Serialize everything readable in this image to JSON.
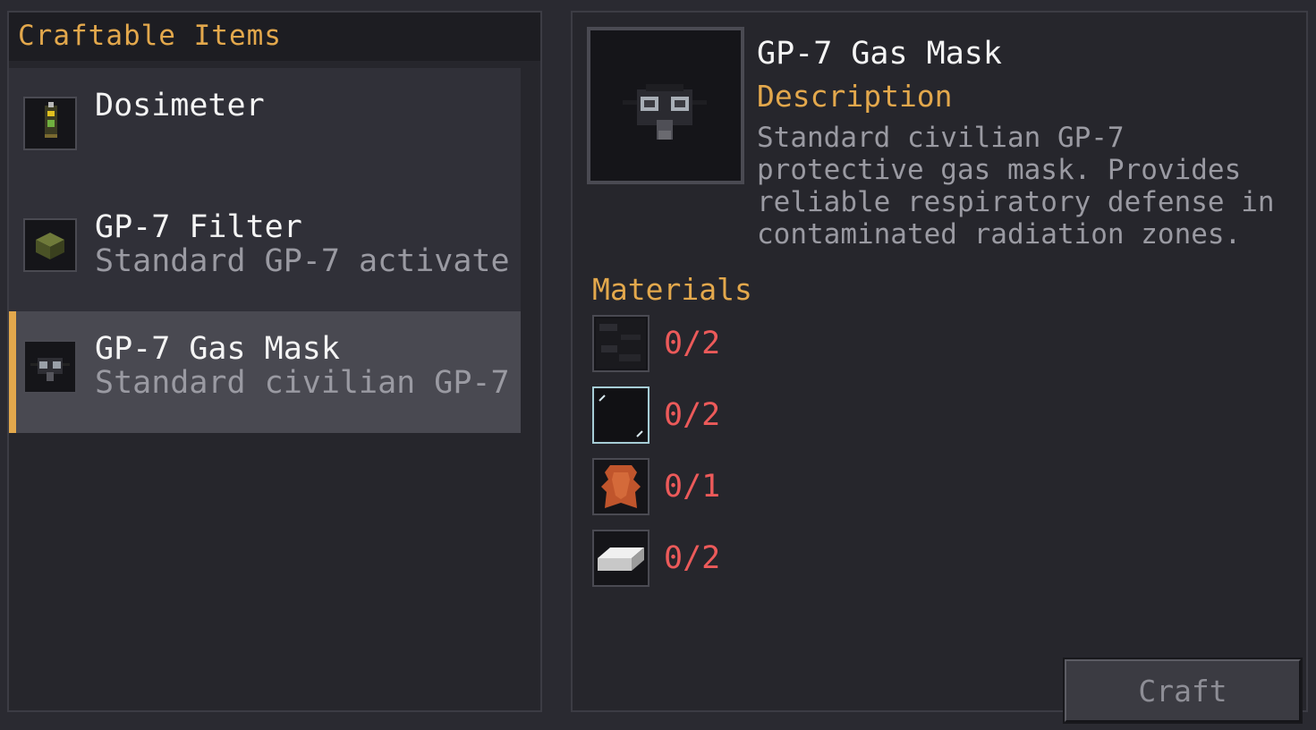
{
  "left_panel": {
    "title": "Craftable Items",
    "recipes": [
      {
        "name": "Dosimeter",
        "description": "",
        "icon": "dosimeter-icon",
        "selected": false
      },
      {
        "name": "GP-7 Filter",
        "description": "Standard GP-7 activate",
        "icon": "filter-icon",
        "selected": false
      },
      {
        "name": "GP-7 Gas Mask",
        "description": "Standard civilian GP-7",
        "icon": "gas-mask-icon",
        "selected": true
      }
    ]
  },
  "detail": {
    "item_name": "GP-7 Gas Mask",
    "description_heading": "Description",
    "description": "Standard civilian GP-7 protective gas mask. Provides reliable respiratory defense in contaminated radiation zones.",
    "materials_heading": "Materials",
    "materials": [
      {
        "icon": "coal-block-icon",
        "count": "0/2"
      },
      {
        "icon": "glass-pane-icon",
        "count": "0/2"
      },
      {
        "icon": "leather-icon",
        "count": "0/1"
      },
      {
        "icon": "iron-ingot-icon",
        "count": "0/2"
      }
    ]
  },
  "craft_button": {
    "label": "Craft",
    "enabled": false
  },
  "colors": {
    "accent": "#e3a84c",
    "missing": "#ec5a5a",
    "panel": "#26262c"
  }
}
